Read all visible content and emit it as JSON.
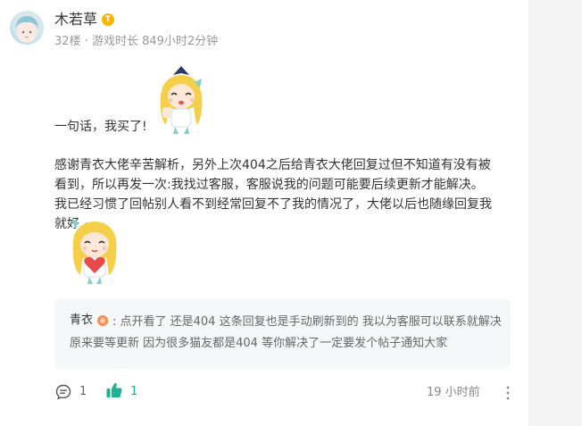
{
  "post": {
    "author": "木若草",
    "author_badge": "T",
    "meta": "32楼 · 游戏时长 849小时2分钟",
    "line1": "一句话，我买了!",
    "paragraph": "感谢青衣大佬辛苦解析，另外上次404之后给青衣大佬回复过但不知道有没有被看到，所以再发一次:我找过客服，客服说我的问题可能要后续更新才能解决。我已经习惯了回帖别人看不到经常回复不了我的情况了，大佬以后也随缘回复我就好 ~"
  },
  "reply": {
    "name": "青衣",
    "text": ": 点开看了 还是404 这条回复也是手动刷新到的 我以为客服可以联系就解决 原来要等更新 因为很多猫友都是404 等你解决了一定要发个帖子通知大家"
  },
  "footer": {
    "comment_count": "1",
    "like_count": "1",
    "time": "19 小时前"
  },
  "icons": {
    "comment": "comment-icon",
    "like": "thumbs-up-icon",
    "more": "more-vertical-icon"
  },
  "colors": {
    "accent": "#1ab394",
    "badge": "#f7b500",
    "reply_badge": "#ff8a4c"
  }
}
